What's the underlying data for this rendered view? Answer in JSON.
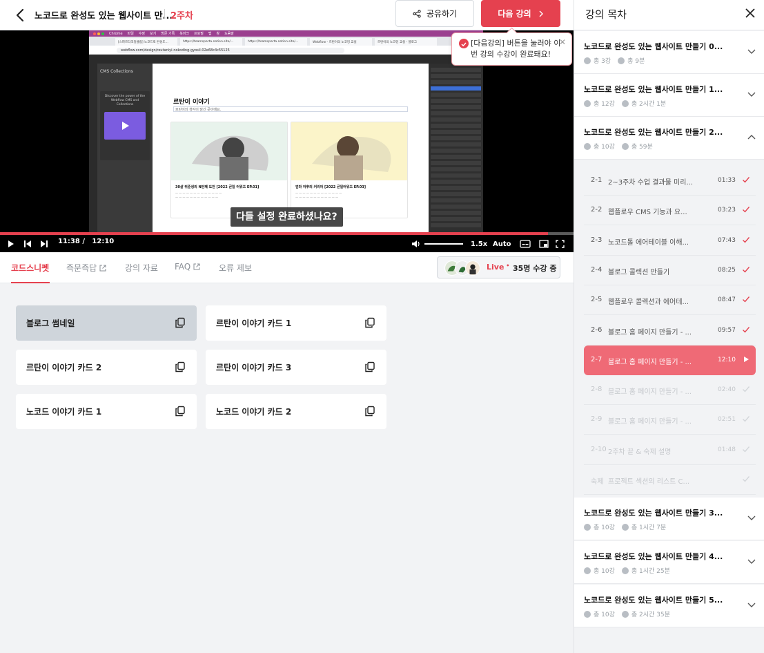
{
  "header": {
    "course_title": "노코드로 완성도 있는 웹사이트 만...",
    "week": "2주차",
    "share_label": "공유하기",
    "next_label": "다음 강의"
  },
  "tooltip": {
    "text": "[다음강의] 버튼을 눌러야 이번 강의 수강이 완료돼요!"
  },
  "video": {
    "subtitle": "다들 설정 완료하셨나요?",
    "current_time": "11:38 /",
    "total_time": "12:10",
    "progress": 0.956,
    "speed": "1.5x",
    "quality": "Auto",
    "screen": {
      "mac_menu": [
        "Chrome",
        "파일",
        "수정",
        "보기",
        "방문 기록",
        "북마크",
        "프로필",
        "탭",
        "창",
        "도움말"
      ],
      "browser_tabs": [
        "[스파르타코딩클럽] 노코드로 완성도...",
        "https://teamsparta.notion.site/...",
        "https://teamsparta.notion.site/...",
        "Webflow - 르탄이의 노코딩 교실",
        "르탄이의 노코딩 교실 - 블로그"
      ],
      "url": "webflow.com/design/reutaniyi-nokoding-gyosil-02e68c4c55125",
      "panel_title": "CMS Collections",
      "promo_text": "Discover the power of the Webflow CMS and Collections",
      "page_heading": "르탄이 이야기",
      "page_sub": "르탄이의 생각이 담긴 곳이에요.",
      "card1_caption": "30살 취준생의 N번째 도전 [2022 큰일 어워즈 EP.01]",
      "card2_caption": "엄마 아후의 커리어 [2022 큰일어워즈 EP.03]"
    }
  },
  "tabs": [
    {
      "label": "코드스니펫",
      "active": true
    },
    {
      "label": "즉문즉답",
      "active": false
    },
    {
      "label": "강의 자료",
      "active": false
    },
    {
      "label": "FAQ",
      "active": false
    },
    {
      "label": "오류 제보",
      "active": false
    }
  ],
  "live": {
    "label": "Live",
    "count": "35명 수강 중"
  },
  "snippets": [
    {
      "label": "블로그 썸네일",
      "selected": true
    },
    {
      "label": "르탄이 이야기 카드 1",
      "selected": false
    },
    {
      "label": "르탄이 이야기 카드 2",
      "selected": false
    },
    {
      "label": "르탄이 이야기 카드 3",
      "selected": false
    },
    {
      "label": "노코드 이야기 카드 1",
      "selected": false
    },
    {
      "label": "노코드 이야기 카드 2",
      "selected": false
    }
  ],
  "sidebar": {
    "title": "강의 목차",
    "chapters": [
      {
        "title": "노코드로 완성도 있는 웹사이트 만들기 0...",
        "count": "총 3강",
        "duration": "총 9분"
      },
      {
        "title": "노코드로 완성도 있는 웹사이트 만들기 1...",
        "count": "총 12강",
        "duration": "총 2시간 1분"
      },
      {
        "title": "노코드로 완성도 있는 웹사이트 만들기 2...",
        "count": "총 10강",
        "duration": "총 59분"
      },
      {
        "title": "노코드로 완성도 있는 웹사이트 만들기 3...",
        "count": "총 10강",
        "duration": "총 1시간 7분"
      },
      {
        "title": "노코드로 완성도 있는 웹사이트 만들기 4...",
        "count": "총 10강",
        "duration": "총 1시간 25분"
      },
      {
        "title": "노코드로 완성도 있는 웹사이트 만들기 5...",
        "count": "총 10강",
        "duration": "총 2시간 35분"
      }
    ],
    "lessons": [
      {
        "num": "2-1",
        "title": "2~3주차 수업 결과물 미리...",
        "time": "01:33",
        "state": "done"
      },
      {
        "num": "2-2",
        "title": "웹플로우 CMS 기능과 요...",
        "time": "03:23",
        "state": "done"
      },
      {
        "num": "2-3",
        "title": "노코드톨 에어테이블 이해...",
        "time": "07:43",
        "state": "done"
      },
      {
        "num": "2-4",
        "title": "블로그 콜렉션 만들기",
        "time": "08:25",
        "state": "done"
      },
      {
        "num": "2-5",
        "title": "웹플로우 콜렉션과 에어테...",
        "time": "08:47",
        "state": "done"
      },
      {
        "num": "2-6",
        "title": "블로그 홈 페이지 만들기 - ...",
        "time": "09:57",
        "state": "done"
      },
      {
        "num": "2-7",
        "title": "블로그 홈 페이지 만들기 - ...",
        "time": "12:10",
        "state": "current"
      },
      {
        "num": "2-8",
        "title": "블로그 홈 페이지 만들기 - ...",
        "time": "02:40",
        "state": "future"
      },
      {
        "num": "2-9",
        "title": "블로그 홈 페이지 만들기 - ...",
        "time": "02:51",
        "state": "future"
      },
      {
        "num": "2-10",
        "title": "2주차 끝 & 숙제 설명",
        "time": "01:48",
        "state": "future"
      },
      {
        "num": "숙제",
        "title": "프로젝트 섹션의 리스트 C...",
        "time": "",
        "state": "future"
      }
    ]
  },
  "colors": {
    "accent": "#e5414f",
    "current_lesson": "#ef6a76",
    "background": "#f2f3f5"
  }
}
